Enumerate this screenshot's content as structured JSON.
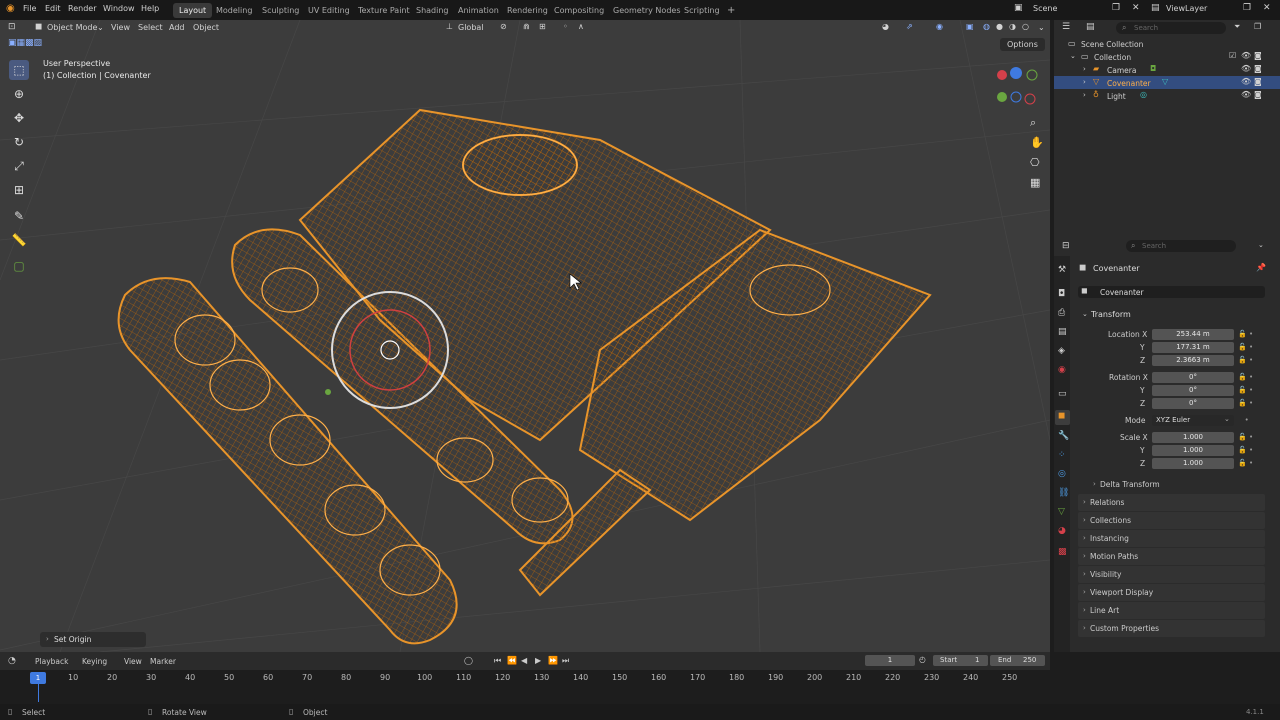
{
  "topbar": {
    "menus": [
      "File",
      "Edit",
      "Render",
      "Window",
      "Help"
    ],
    "workspaces": [
      "Layout",
      "Modeling",
      "Sculpting",
      "UV Editing",
      "Texture Paint",
      "Shading",
      "Animation",
      "Rendering",
      "Compositing",
      "Geometry Nodes",
      "Scripting"
    ],
    "active_workspace": "Layout",
    "add_tab": "+",
    "scene": "Scene",
    "view_layer": "ViewLayer"
  },
  "viewport_header": {
    "mode": "Object Mode",
    "menus": [
      "View",
      "Select",
      "Add",
      "Object"
    ],
    "orientation": "Global",
    "options": "Options"
  },
  "viewport": {
    "perspective": "User Perspective",
    "collection_info": "(1) Collection | Covenanter",
    "last_operator": "Set Origin",
    "wire_color": "#e8942a"
  },
  "outliner": {
    "search_placeholder": "Search",
    "root": "Scene Collection",
    "collection": "Collection",
    "items": [
      "Camera",
      "Covenanter",
      "Light"
    ]
  },
  "properties": {
    "search_placeholder": "Search",
    "object_name": "Covenanter",
    "object_field": "Covenanter",
    "transform": {
      "header": "Transform",
      "location_label": "Location X",
      "y_label": "Y",
      "z_label": "Z",
      "location": [
        "253.44 m",
        "177.31 m",
        "2.3663 m"
      ],
      "rotation_label": "Rotation X",
      "rotation": [
        "0°",
        "0°",
        "0°"
      ],
      "mode_label": "Mode",
      "mode_value": "XYZ Euler",
      "scale_label": "Scale X",
      "scale": [
        "1.000",
        "1.000",
        "1.000"
      ],
      "delta": "Delta Transform"
    },
    "sections": [
      "Relations",
      "Collections",
      "Instancing",
      "Motion Paths",
      "Visibility",
      "Viewport Display",
      "Line Art",
      "Custom Properties"
    ]
  },
  "timeline": {
    "menus": [
      "Playback",
      "Keying",
      "View",
      "Marker"
    ],
    "current_frame": "1",
    "start_label": "Start",
    "start": "1",
    "end_label": "End",
    "end": "250",
    "playhead": "1",
    "ticks": [
      "10",
      "20",
      "30",
      "40",
      "50",
      "60",
      "70",
      "80",
      "90",
      "100",
      "110",
      "120",
      "130",
      "140",
      "150",
      "160",
      "170",
      "180",
      "190",
      "200",
      "210",
      "220",
      "230",
      "240",
      "250"
    ]
  },
  "statusbar": {
    "select": "Select",
    "rotate": "Rotate View",
    "object": "Object",
    "version": "4.1.1"
  }
}
